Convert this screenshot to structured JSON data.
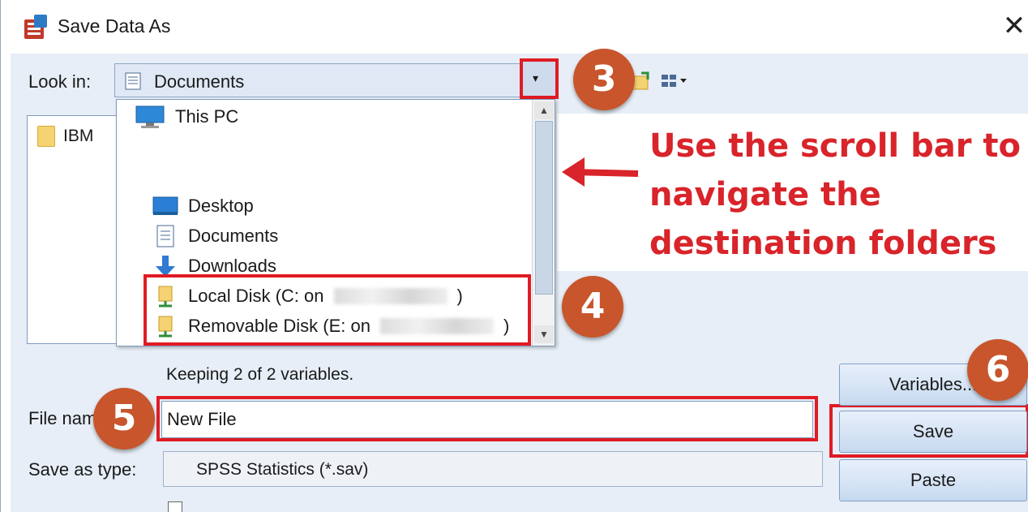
{
  "window": {
    "title": "Save Data As",
    "close_glyph": "✕"
  },
  "look_in": {
    "label": "Look in:",
    "value": "Documents",
    "dropdown_glyph": "▾"
  },
  "file_list": {
    "items": [
      {
        "label": "IBM",
        "icon": "folder-icon"
      }
    ]
  },
  "look_in_dropdown": {
    "items": [
      {
        "label": "This PC",
        "icon": "computer-icon"
      },
      {
        "label": "Desktop",
        "icon": "desktop-icon"
      },
      {
        "label": "Documents",
        "icon": "documents-icon"
      },
      {
        "label": "Downloads",
        "icon": "downloads-icon"
      },
      {
        "label": "Local Disk (C: on",
        "suffix": ")",
        "icon": "network-drive-icon"
      },
      {
        "label": "Removable Disk (E: on",
        "suffix": ")",
        "icon": "network-drive-icon"
      }
    ],
    "scroll_up_glyph": "▲",
    "scroll_down_glyph": "▼"
  },
  "annotation": {
    "text": "Use the scroll bar to navigate the destination folders",
    "color": "#d8242a",
    "callouts": [
      "3",
      "4",
      "5",
      "6"
    ]
  },
  "status": "Keeping 2 of 2 variables.",
  "file_name": {
    "label": "File name:",
    "value": "New File"
  },
  "save_as_type": {
    "label": "Save as type:",
    "value": "SPSS Statistics (*.sav)"
  },
  "buttons": {
    "variables": "Variables...",
    "save": "Save",
    "paste": "Paste"
  },
  "colors": {
    "accent_red": "#e01b24",
    "callout_orange": "#c8552b",
    "dialog_bg": "#e7eef7"
  }
}
